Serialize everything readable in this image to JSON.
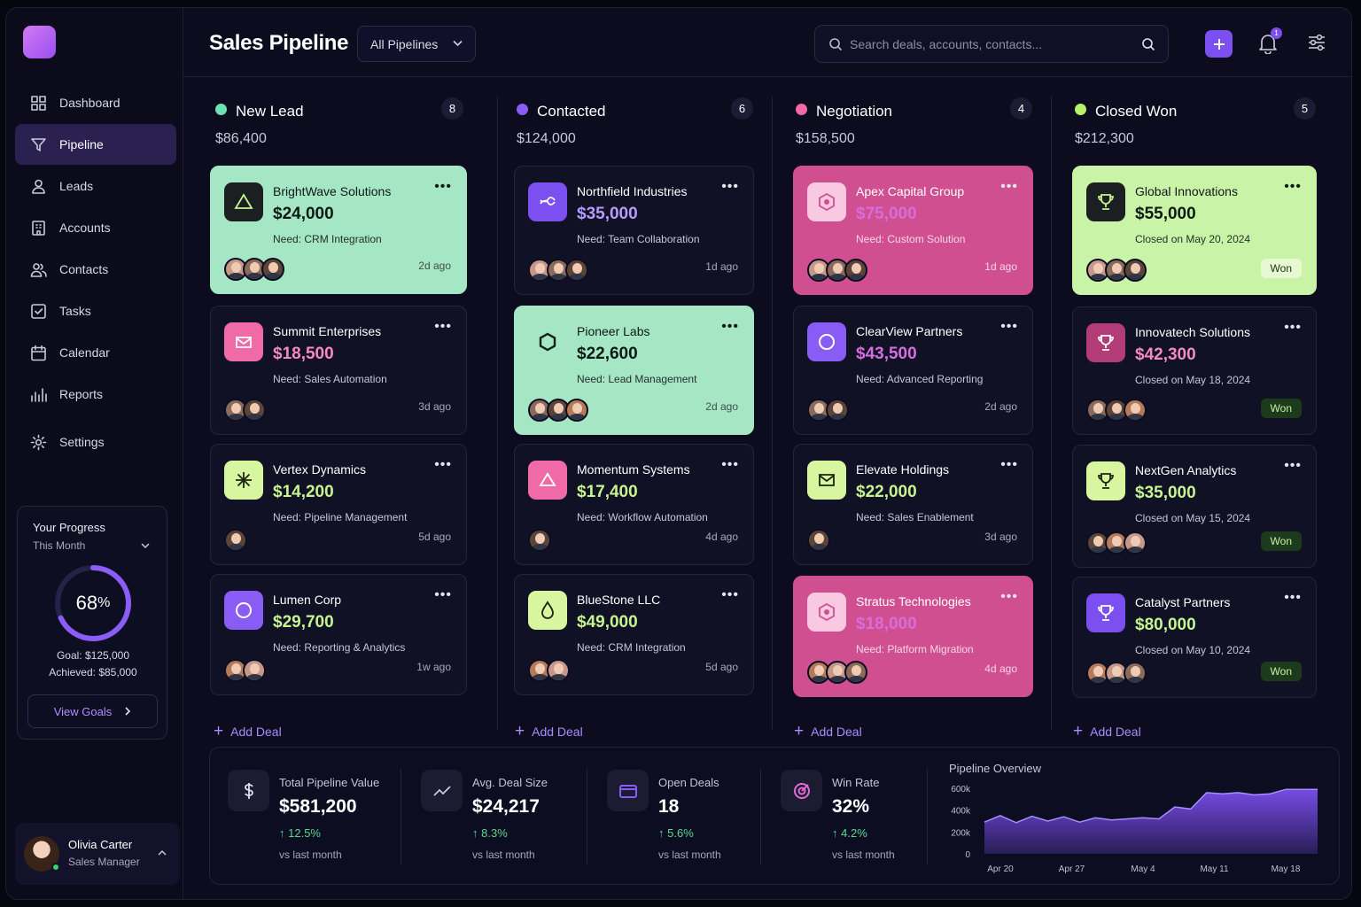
{
  "app": {
    "title": "Sales Pipeline",
    "pipeline_filter": "All Pipelines",
    "search_placeholder": "Search deals, accounts, contacts...",
    "notifications": "1",
    "accent": "#7c4ff0"
  },
  "sidebar": {
    "items": [
      {
        "label": "Dashboard",
        "icon": "grid-icon"
      },
      {
        "label": "Pipeline",
        "icon": "funnel-icon",
        "active": true
      },
      {
        "label": "Leads",
        "icon": "user-icon"
      },
      {
        "label": "Accounts",
        "icon": "building-icon"
      },
      {
        "label": "Contacts",
        "icon": "users-icon"
      },
      {
        "label": "Tasks",
        "icon": "checkbox-icon"
      },
      {
        "label": "Calendar",
        "icon": "calendar-icon"
      },
      {
        "label": "Reports",
        "icon": "bar-chart-icon"
      },
      {
        "label": "Settings",
        "icon": "gear-icon"
      }
    ]
  },
  "progress": {
    "title": "Your Progress",
    "period": "This Month",
    "percent_value": 68,
    "percent": "68",
    "percent_sign": "%",
    "goal": "Goal: $125,000",
    "achieved": "Achieved: $85,000",
    "button": "View Goals"
  },
  "user": {
    "name": "Olivia Carter",
    "role": "Sales Manager"
  },
  "columns": [
    {
      "name": "New Lead",
      "amount": "$86,400",
      "count": "8",
      "color": "#6fe0b4",
      "add": "Add Deal",
      "cards": [
        {
          "name": "BrightWave Solutions",
          "value": "$24,000",
          "note": "Need: CRM Integration",
          "ago": "2d ago",
          "theme": "mint",
          "avatars": 3
        },
        {
          "name": "Summit Enterprises",
          "value": "$18,500",
          "note": "Need: Sales Automation",
          "ago": "3d ago",
          "theme": "dark",
          "avatars": 2
        },
        {
          "name": "Vertex Dynamics",
          "value": "$14,200",
          "note": "Need: Pipeline Management",
          "ago": "5d ago",
          "theme": "dark",
          "avatars": 1
        },
        {
          "name": "Lumen Corp",
          "value": "$29,700",
          "note": "Need: Reporting & Analytics",
          "ago": "1w ago",
          "theme": "dark",
          "avatars": 2
        }
      ]
    },
    {
      "name": "Contacted",
      "amount": "$124,000",
      "count": "6",
      "color": "#8a5cf6",
      "add": "Add Deal",
      "cards": [
        {
          "name": "Northfield Industries",
          "value": "$35,000",
          "note": "Need: Team Collaboration",
          "ago": "1d ago",
          "theme": "dark",
          "avatars": 3
        },
        {
          "name": "Pioneer Labs",
          "value": "$22,600",
          "note": "Need: Lead Management",
          "ago": "2d ago",
          "theme": "mint",
          "avatars": 3
        },
        {
          "name": "Momentum Systems",
          "value": "$17,400",
          "note": "Need: Workflow Automation",
          "ago": "4d ago",
          "theme": "dark",
          "avatars": 1
        },
        {
          "name": "BlueStone LLC",
          "value": "$49,000",
          "note": "Need: CRM Integration",
          "ago": "5d ago",
          "theme": "dark",
          "avatars": 2
        }
      ]
    },
    {
      "name": "Negotiation",
      "amount": "$158,500",
      "count": "4",
      "color": "#f06aa8",
      "add": "Add Deal",
      "cards": [
        {
          "name": "Apex Capital Group",
          "value": "$75,000",
          "note": "Need: Custom Solution",
          "ago": "1d ago",
          "theme": "pink",
          "avatars": 3
        },
        {
          "name": "ClearView Partners",
          "value": "$43,500",
          "note": "Need: Advanced Reporting",
          "ago": "2d ago",
          "theme": "dark",
          "avatars": 2
        },
        {
          "name": "Elevate Holdings",
          "value": "$22,000",
          "note": "Need: Sales Enablement",
          "ago": "3d ago",
          "theme": "dark",
          "avatars": 1
        },
        {
          "name": "Stratus Technologies",
          "value": "$18,000",
          "note": "Need: Platform Migration",
          "ago": "4d ago",
          "theme": "pink",
          "avatars": 3
        }
      ]
    },
    {
      "name": "Closed Won",
      "amount": "$212,300",
      "count": "5",
      "color": "#b8f26a",
      "add": "Add Deal",
      "cards": [
        {
          "name": "Global Innovations",
          "value": "$55,000",
          "note": "Closed on May 20, 2024",
          "badge": "Won",
          "theme": "lime",
          "avatars": 3
        },
        {
          "name": "Innovatech Solutions",
          "value": "$42,300",
          "note": "Closed on May 18, 2024",
          "badge": "Won",
          "theme": "dark",
          "avatars": 3
        },
        {
          "name": "NextGen Analytics",
          "value": "$35,000",
          "note": "Closed on May 15, 2024",
          "badge": "Won",
          "theme": "dark",
          "avatars": 3
        },
        {
          "name": "Catalyst Partners",
          "value": "$80,000",
          "note": "Closed on May 10, 2024",
          "badge": "Won",
          "theme": "dark",
          "avatars": 3
        }
      ]
    }
  ],
  "stats": [
    {
      "label": "Total Pipeline Value",
      "value": "$581,200",
      "change": "12.5%",
      "sub": "vs last month",
      "icon": "dollar-icon"
    },
    {
      "label": "Avg. Deal Size",
      "value": "$24,217",
      "change": "8.3%",
      "sub": "vs last month",
      "icon": "trend-icon"
    },
    {
      "label": "Open Deals",
      "value": "18",
      "change": "5.6%",
      "sub": "vs last month",
      "icon": "folder-icon"
    },
    {
      "label": "Win Rate",
      "value": "32%",
      "change": "4.2%",
      "sub": "vs last month",
      "icon": "target-icon"
    }
  ],
  "chart_data": {
    "type": "area",
    "title": "Pipeline Overview",
    "x": [
      "Apr 20",
      "Apr 27",
      "May 4",
      "May 11",
      "May 18"
    ],
    "x_ticks": [
      "Apr 20",
      "Apr 27",
      "May 4",
      "May 11",
      "May 18"
    ],
    "y_ticks": [
      "600k",
      "400k",
      "200k",
      "0"
    ],
    "ylim": [
      0,
      600000
    ],
    "series": [
      {
        "values": [
          290000,
          350000,
          285000,
          345000,
          300000,
          340000,
          290000,
          330000,
          310000,
          320000,
          330000,
          320000,
          430000,
          410000,
          560000,
          550000,
          560000,
          540000,
          550000,
          590000,
          590000,
          590000
        ]
      }
    ],
    "color": "#7c4ff0"
  }
}
